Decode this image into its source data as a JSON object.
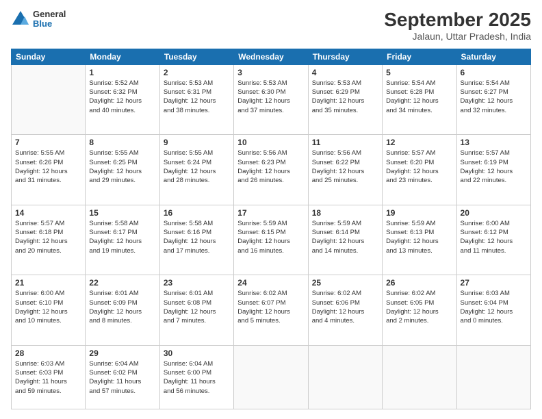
{
  "logo": {
    "general": "General",
    "blue": "Blue"
  },
  "header": {
    "month": "September 2025",
    "location": "Jalaun, Uttar Pradesh, India"
  },
  "weekdays": [
    "Sunday",
    "Monday",
    "Tuesday",
    "Wednesday",
    "Thursday",
    "Friday",
    "Saturday"
  ],
  "weeks": [
    [
      {
        "day": "",
        "info": ""
      },
      {
        "day": "1",
        "info": "Sunrise: 5:52 AM\nSunset: 6:32 PM\nDaylight: 12 hours\nand 40 minutes."
      },
      {
        "day": "2",
        "info": "Sunrise: 5:53 AM\nSunset: 6:31 PM\nDaylight: 12 hours\nand 38 minutes."
      },
      {
        "day": "3",
        "info": "Sunrise: 5:53 AM\nSunset: 6:30 PM\nDaylight: 12 hours\nand 37 minutes."
      },
      {
        "day": "4",
        "info": "Sunrise: 5:53 AM\nSunset: 6:29 PM\nDaylight: 12 hours\nand 35 minutes."
      },
      {
        "day": "5",
        "info": "Sunrise: 5:54 AM\nSunset: 6:28 PM\nDaylight: 12 hours\nand 34 minutes."
      },
      {
        "day": "6",
        "info": "Sunrise: 5:54 AM\nSunset: 6:27 PM\nDaylight: 12 hours\nand 32 minutes."
      }
    ],
    [
      {
        "day": "7",
        "info": "Sunrise: 5:55 AM\nSunset: 6:26 PM\nDaylight: 12 hours\nand 31 minutes."
      },
      {
        "day": "8",
        "info": "Sunrise: 5:55 AM\nSunset: 6:25 PM\nDaylight: 12 hours\nand 29 minutes."
      },
      {
        "day": "9",
        "info": "Sunrise: 5:55 AM\nSunset: 6:24 PM\nDaylight: 12 hours\nand 28 minutes."
      },
      {
        "day": "10",
        "info": "Sunrise: 5:56 AM\nSunset: 6:23 PM\nDaylight: 12 hours\nand 26 minutes."
      },
      {
        "day": "11",
        "info": "Sunrise: 5:56 AM\nSunset: 6:22 PM\nDaylight: 12 hours\nand 25 minutes."
      },
      {
        "day": "12",
        "info": "Sunrise: 5:57 AM\nSunset: 6:20 PM\nDaylight: 12 hours\nand 23 minutes."
      },
      {
        "day": "13",
        "info": "Sunrise: 5:57 AM\nSunset: 6:19 PM\nDaylight: 12 hours\nand 22 minutes."
      }
    ],
    [
      {
        "day": "14",
        "info": "Sunrise: 5:57 AM\nSunset: 6:18 PM\nDaylight: 12 hours\nand 20 minutes."
      },
      {
        "day": "15",
        "info": "Sunrise: 5:58 AM\nSunset: 6:17 PM\nDaylight: 12 hours\nand 19 minutes."
      },
      {
        "day": "16",
        "info": "Sunrise: 5:58 AM\nSunset: 6:16 PM\nDaylight: 12 hours\nand 17 minutes."
      },
      {
        "day": "17",
        "info": "Sunrise: 5:59 AM\nSunset: 6:15 PM\nDaylight: 12 hours\nand 16 minutes."
      },
      {
        "day": "18",
        "info": "Sunrise: 5:59 AM\nSunset: 6:14 PM\nDaylight: 12 hours\nand 14 minutes."
      },
      {
        "day": "19",
        "info": "Sunrise: 5:59 AM\nSunset: 6:13 PM\nDaylight: 12 hours\nand 13 minutes."
      },
      {
        "day": "20",
        "info": "Sunrise: 6:00 AM\nSunset: 6:12 PM\nDaylight: 12 hours\nand 11 minutes."
      }
    ],
    [
      {
        "day": "21",
        "info": "Sunrise: 6:00 AM\nSunset: 6:10 PM\nDaylight: 12 hours\nand 10 minutes."
      },
      {
        "day": "22",
        "info": "Sunrise: 6:01 AM\nSunset: 6:09 PM\nDaylight: 12 hours\nand 8 minutes."
      },
      {
        "day": "23",
        "info": "Sunrise: 6:01 AM\nSunset: 6:08 PM\nDaylight: 12 hours\nand 7 minutes."
      },
      {
        "day": "24",
        "info": "Sunrise: 6:02 AM\nSunset: 6:07 PM\nDaylight: 12 hours\nand 5 minutes."
      },
      {
        "day": "25",
        "info": "Sunrise: 6:02 AM\nSunset: 6:06 PM\nDaylight: 12 hours\nand 4 minutes."
      },
      {
        "day": "26",
        "info": "Sunrise: 6:02 AM\nSunset: 6:05 PM\nDaylight: 12 hours\nand 2 minutes."
      },
      {
        "day": "27",
        "info": "Sunrise: 6:03 AM\nSunset: 6:04 PM\nDaylight: 12 hours\nand 0 minutes."
      }
    ],
    [
      {
        "day": "28",
        "info": "Sunrise: 6:03 AM\nSunset: 6:03 PM\nDaylight: 11 hours\nand 59 minutes."
      },
      {
        "day": "29",
        "info": "Sunrise: 6:04 AM\nSunset: 6:02 PM\nDaylight: 11 hours\nand 57 minutes."
      },
      {
        "day": "30",
        "info": "Sunrise: 6:04 AM\nSunset: 6:00 PM\nDaylight: 11 hours\nand 56 minutes."
      },
      {
        "day": "",
        "info": ""
      },
      {
        "day": "",
        "info": ""
      },
      {
        "day": "",
        "info": ""
      },
      {
        "day": "",
        "info": ""
      }
    ]
  ]
}
